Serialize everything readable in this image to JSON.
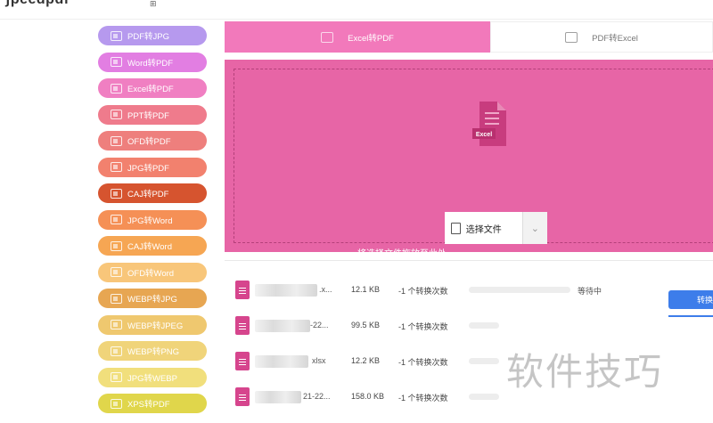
{
  "app": {
    "logo_text": "ʃpeedpdf",
    "top_icon": "⊞"
  },
  "sidebar": {
    "items": [
      {
        "label": "PDF转JPG",
        "color": "#b699ee"
      },
      {
        "label": "Word转PDF",
        "color": "#e27ee2"
      },
      {
        "label": "Excel转PDF",
        "color": "#f07fc2"
      },
      {
        "label": "PPT转PDF",
        "color": "#ef7b8c"
      },
      {
        "label": "OFD转PDF",
        "color": "#ee7f7d"
      },
      {
        "label": "JPG转PDF",
        "color": "#f2816e"
      },
      {
        "label": "CAJ转PDF",
        "color": "#d6542f"
      },
      {
        "label": "JPG转Word",
        "color": "#f59056"
      },
      {
        "label": "CAJ转Word",
        "color": "#f6a653"
      },
      {
        "label": "OFD转Word",
        "color": "#f8c67a"
      },
      {
        "label": "WEBP转JPG",
        "color": "#e7a652"
      },
      {
        "label": "WEBP转JPEG",
        "color": "#efc86f"
      },
      {
        "label": "WEBP转PNG",
        "color": "#f0d47a"
      },
      {
        "label": "JPG转WEBP",
        "color": "#f1df7c"
      },
      {
        "label": "XPS转PDF",
        "color": "#e0d64b"
      }
    ]
  },
  "tabs": [
    {
      "label": "Excel转PDF",
      "active": true
    },
    {
      "label": "PDF转Excel",
      "active": false
    }
  ],
  "dropzone": {
    "icon_label": "Excel",
    "choose_label": "选择文件",
    "hint": "将选择文件拖放至此处",
    "color": "#e765a6"
  },
  "files": [
    {
      "ext": ".x...",
      "size": "12.1 KB",
      "count": "-1 个转换次数",
      "status": "等待中",
      "button": "转换"
    },
    {
      "ext": "-22...",
      "size": "99.5 KB",
      "count": "-1 个转换次数",
      "status": "",
      "button": ""
    },
    {
      "ext": "xlsx",
      "size": "12.2 KB",
      "count": "-1 个转换次数",
      "status": "",
      "button": ""
    },
    {
      "ext": "21-22...",
      "size": "158.0 KB",
      "count": "-1 个转换次数",
      "status": "",
      "button": ""
    }
  ],
  "watermark": "软件技巧"
}
